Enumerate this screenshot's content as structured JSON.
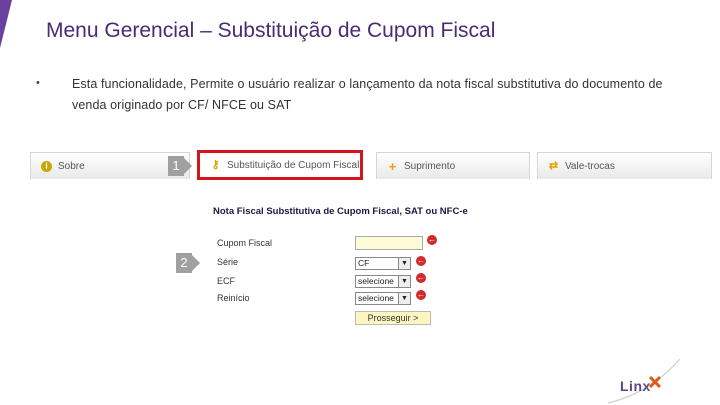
{
  "slide": {
    "title": "Menu Gerencial – Substituição de Cupom Fiscal",
    "bullet": "•",
    "description": "Esta funcionalidade, Permite o usuário realizar o lançamento da nota fiscal substitutiva do documento de venda originado por CF/ NFCE ou SAT"
  },
  "tabs": [
    {
      "label": "Sobre",
      "icon": "info-icon",
      "color": "#c9a800"
    },
    {
      "label": "Substituição de Cupom Fiscal",
      "icon": "key-icon",
      "color": "#c9a800",
      "active": true
    },
    {
      "label": "Suprimento",
      "icon": "plus-icon",
      "color": "#e6a100"
    },
    {
      "label": "Vale-trocas",
      "icon": "exchange-icon",
      "color": "#e6a100"
    }
  ],
  "steps": {
    "one": "1",
    "two": "2"
  },
  "form": {
    "title": "Nota Fiscal Substitutiva de Cupom Fiscal, SAT ou NFC-e",
    "fields": [
      {
        "label": "Cupom Fiscal",
        "value": ""
      },
      {
        "label": "Série",
        "value": "CF"
      },
      {
        "label": "ECF",
        "value": "selecione"
      },
      {
        "label": "Reinício",
        "value": "selecione"
      }
    ],
    "proceed_label": "Prosseguir >"
  },
  "logo": "Linx",
  "colors": {
    "accent": "#4a2a73",
    "highlight": "#d4141b"
  }
}
